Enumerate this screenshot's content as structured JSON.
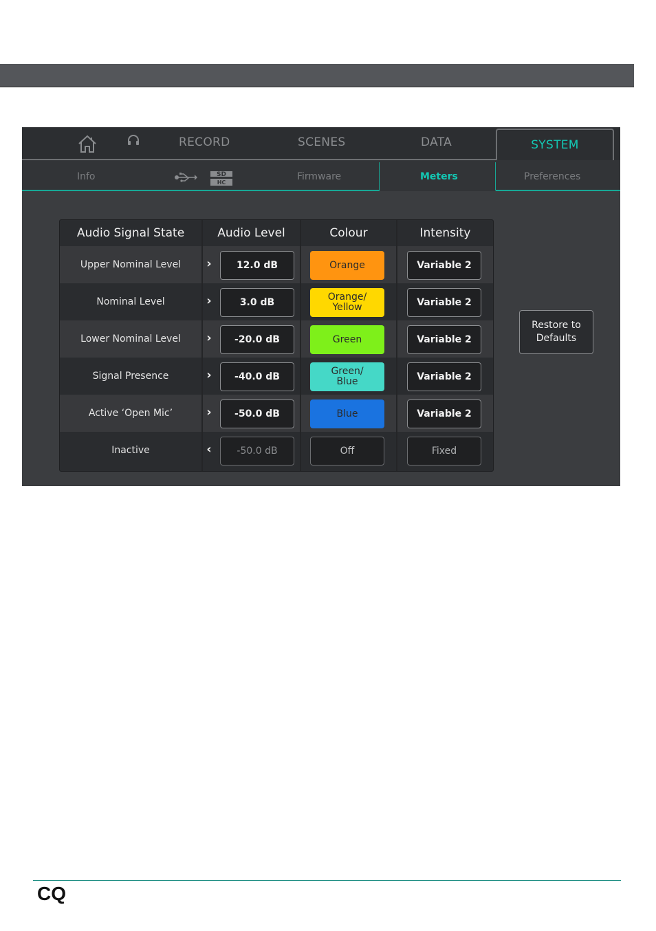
{
  "main_tabs": {
    "home_icon": "home-icon",
    "headphones_icon": "headphones-icon",
    "record": "RECORD",
    "scenes": "SCENES",
    "data": "DATA",
    "system": "SYSTEM"
  },
  "sub_tabs": {
    "info": "Info",
    "usb_icon": "usb-icon",
    "sdhc_icon": "sdhc-icon",
    "firmware": "Firmware",
    "meters": "Meters",
    "preferences": "Preferences"
  },
  "table": {
    "headers": [
      "Audio Signal State",
      "Audio Level",
      "Colour",
      "Intensity"
    ],
    "rows": [
      {
        "state": "Upper Nominal Level",
        "arrow": "›",
        "level": "12.0 dB",
        "colour": "Orange",
        "colour_hex": "#ff9410",
        "intensity": "Variable 2"
      },
      {
        "state": "Nominal Level",
        "arrow": "›",
        "level": "3.0 dB",
        "colour": "Orange/\nYellow",
        "colour_hex": "#ffd800",
        "intensity": "Variable 2"
      },
      {
        "state": "Lower Nominal Level",
        "arrow": "›",
        "level": "-20.0 dB",
        "colour": "Green",
        "colour_hex": "#7ef01a",
        "intensity": "Variable 2"
      },
      {
        "state": "Signal Presence",
        "arrow": "›",
        "level": "-40.0 dB",
        "colour": "Green/\nBlue",
        "colour_hex": "#45d8c7",
        "intensity": "Variable 2"
      },
      {
        "state": "Active ‘Open Mic’",
        "arrow": "›",
        "level": "-50.0 dB",
        "colour": "Blue",
        "colour_hex": "#1a73e0",
        "intensity": "Variable 2"
      },
      {
        "state": "Inactive",
        "arrow": "‹",
        "level": "-50.0 dB",
        "colour": "Off",
        "colour_hex": "",
        "intensity": "Fixed"
      }
    ]
  },
  "restore_button": "Restore to\nDefaults",
  "footer": {
    "brand": "CQ"
  },
  "colors": {
    "accent": "#13c8b4",
    "screen_bg": "#3b3d40"
  }
}
